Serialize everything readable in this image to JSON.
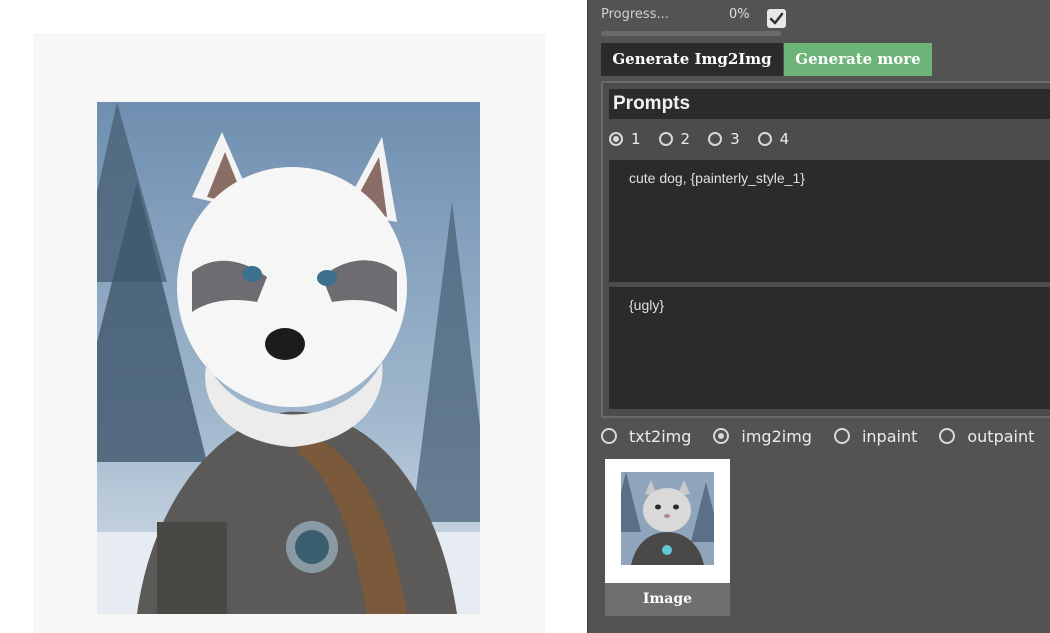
{
  "progress": {
    "label": "Progress...",
    "value_text": "0%",
    "fraction": 0.0,
    "checked": true
  },
  "buttons": {
    "generate": "Generate Img2Img",
    "generate_more": "Generate more"
  },
  "prompts": {
    "title": "Prompts",
    "tabs": [
      "1",
      "2",
      "3",
      "4"
    ],
    "selected_tab": "1",
    "positive": "cute dog, {painterly_style_1}",
    "negative": "{ugly}"
  },
  "modes": {
    "options": [
      "txt2img",
      "img2img",
      "inpaint",
      "outpaint"
    ],
    "selected": "img2img"
  },
  "thumbnail": {
    "caption": "Image",
    "icon": "cat-image-icon"
  },
  "main_image": {
    "icon": "dog-image-icon"
  },
  "colors": {
    "panel_bg": "#535353",
    "accent_green": "#6cb477",
    "dark_bg": "#2b2b2b"
  }
}
